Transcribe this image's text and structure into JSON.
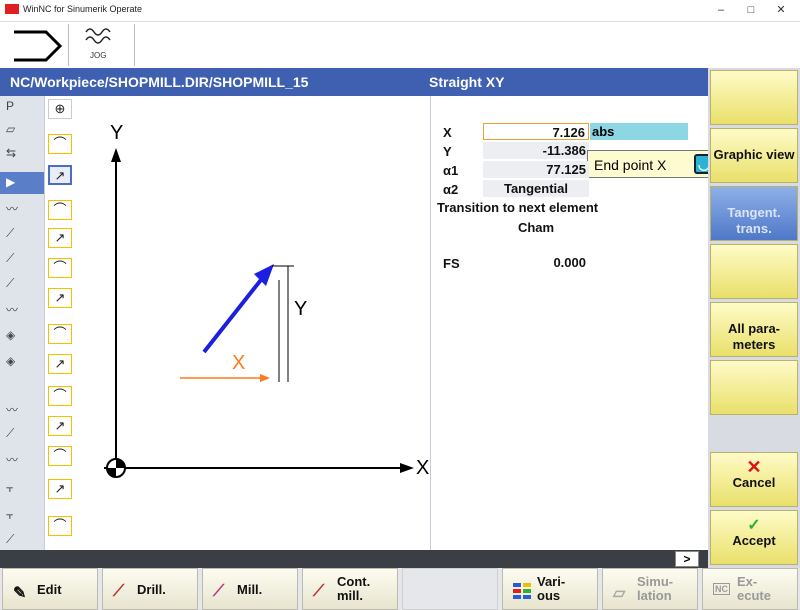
{
  "window": {
    "title": "WinNC for Sinumerik Operate",
    "min": "–",
    "max": "□",
    "close": "✕"
  },
  "toolbar": {
    "jog_label": "JOG"
  },
  "path": {
    "left": "NC/Workpiece/SHOPMILL.DIR/SHOPMILL_15",
    "right": "Straight XY"
  },
  "left_icons": [
    "P",
    "▱",
    "⇆",
    "▶",
    "〰",
    "⟋",
    "⟋",
    "⟋",
    "〰",
    "◈",
    "◈",
    "〰",
    "⟋",
    "〰",
    "⫟",
    "⫟",
    "⟋"
  ],
  "segment_icons": [
    "⊕",
    "⌒",
    "↗",
    "⌒",
    "↗",
    "⌒",
    "↗",
    "⌒",
    "↗",
    "⌒",
    "↗",
    "⌒",
    "↗",
    "⌒"
  ],
  "graphic": {
    "y_axis": "Y",
    "x_axis": "X",
    "x_dim": "X",
    "y_dim": "Y",
    "colors": {
      "line": "#1a1fe0",
      "dim_x": "#ff7a1a"
    }
  },
  "params": {
    "x_label": "X",
    "x_value": "7.126",
    "x_unit": "abs",
    "y_label": "Y",
    "y_value": "-11.386",
    "a1_label": "α1",
    "a1_value": "77.125",
    "a2_label": "α2",
    "a2_value": "Tangential",
    "transition_label": "Transition to next element",
    "transition_value": "Cham",
    "fs_label": "FS",
    "fs_value": "0.000",
    "tooltip": "End point X"
  },
  "softkeys": {
    "graphic_view": "Graphic view",
    "tangent": "Tangent. trans.",
    "all_params": "All para- meters",
    "cancel": "Cancel",
    "accept": "Accept"
  },
  "scroll_more": ">",
  "hkeys": {
    "edit": "Edit",
    "drill": "Drill.",
    "mill": "Mill.",
    "cont_mill": "Cont. mill.",
    "various": "Vari- ous",
    "simulation": "Simu- lation",
    "execute": "Ex- ecute",
    "nc_badge": "NC"
  }
}
